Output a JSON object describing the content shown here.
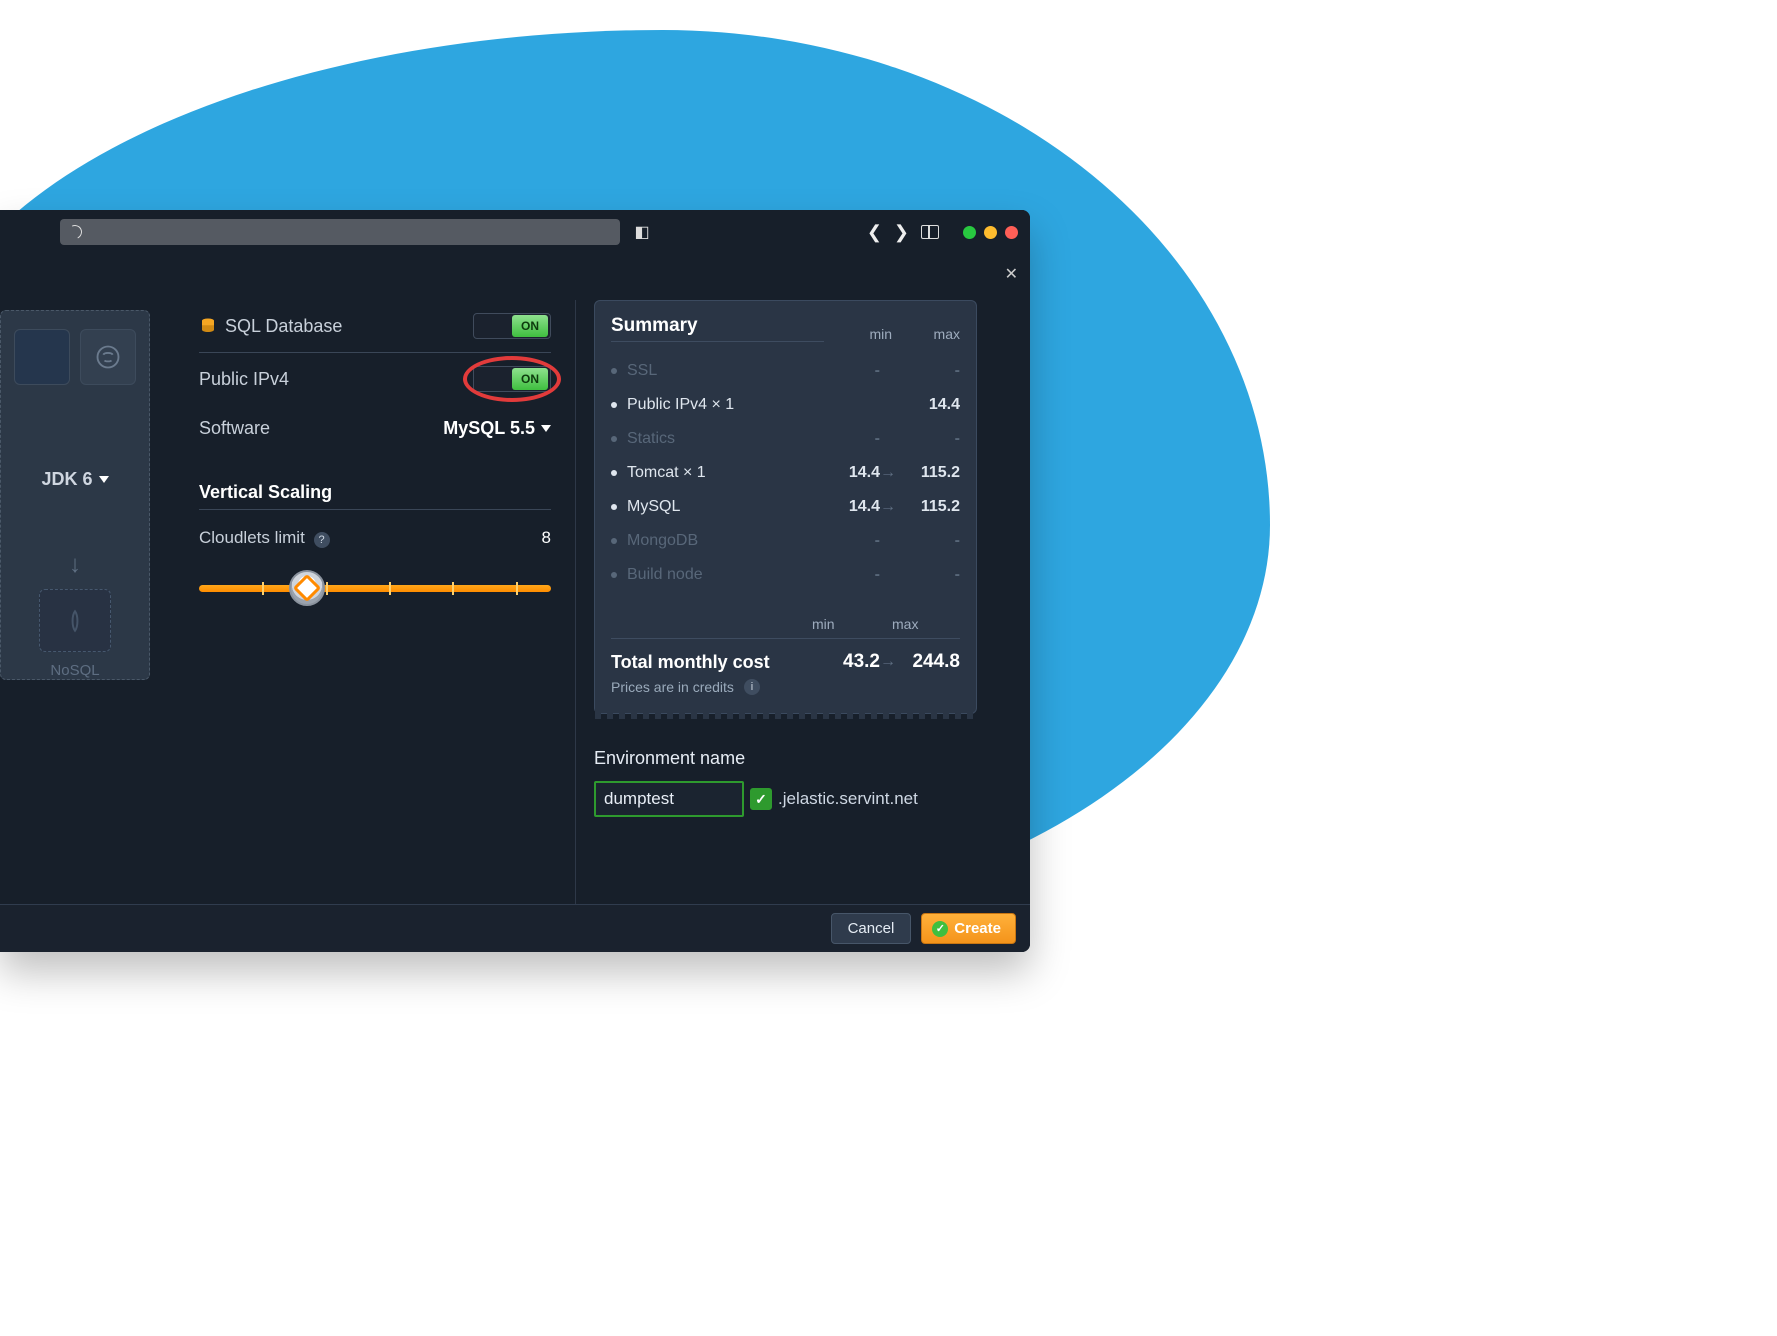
{
  "browser": {
    "shield_icon": "shield"
  },
  "left": {
    "jdk_label": "JDK 6",
    "nosql_label": "NoSQL"
  },
  "settings": {
    "sql_db_label": "SQL Database",
    "sql_db_toggle": "ON",
    "public_ipv4_label": "Public IPv4",
    "public_ipv4_toggle": "ON",
    "software_label": "Software",
    "software_value": "MySQL 5.5",
    "vertical_scaling_title": "Vertical Scaling",
    "cloudlets_label": "Cloudlets limit",
    "cloudlets_value": "8"
  },
  "summary": {
    "title": "Summary",
    "col_min": "min",
    "col_max": "max",
    "rows": [
      {
        "name": "SSL",
        "active": false,
        "min": "-",
        "max": "-"
      },
      {
        "name": "Public IPv4 × 1",
        "active": true,
        "min": "",
        "max": "14.4"
      },
      {
        "name": "Statics",
        "active": false,
        "min": "-",
        "max": "-"
      },
      {
        "name": "Tomcat × 1",
        "active": true,
        "min": "14.4",
        "max": "115.2"
      },
      {
        "name": "MySQL",
        "active": true,
        "min": "14.4",
        "max": "115.2"
      },
      {
        "name": "MongoDB",
        "active": false,
        "min": "-",
        "max": "-"
      },
      {
        "name": "Build node",
        "active": false,
        "min": "-",
        "max": "-"
      }
    ],
    "total_label": "Total monthly cost",
    "total_min": "43.2",
    "total_max": "244.8",
    "credits_note": "Prices are in credits"
  },
  "env": {
    "label": "Environment name",
    "value": "dumptest",
    "domain": ".jelastic.servint.net"
  },
  "actions": {
    "cancel": "Cancel",
    "create": "Create"
  }
}
